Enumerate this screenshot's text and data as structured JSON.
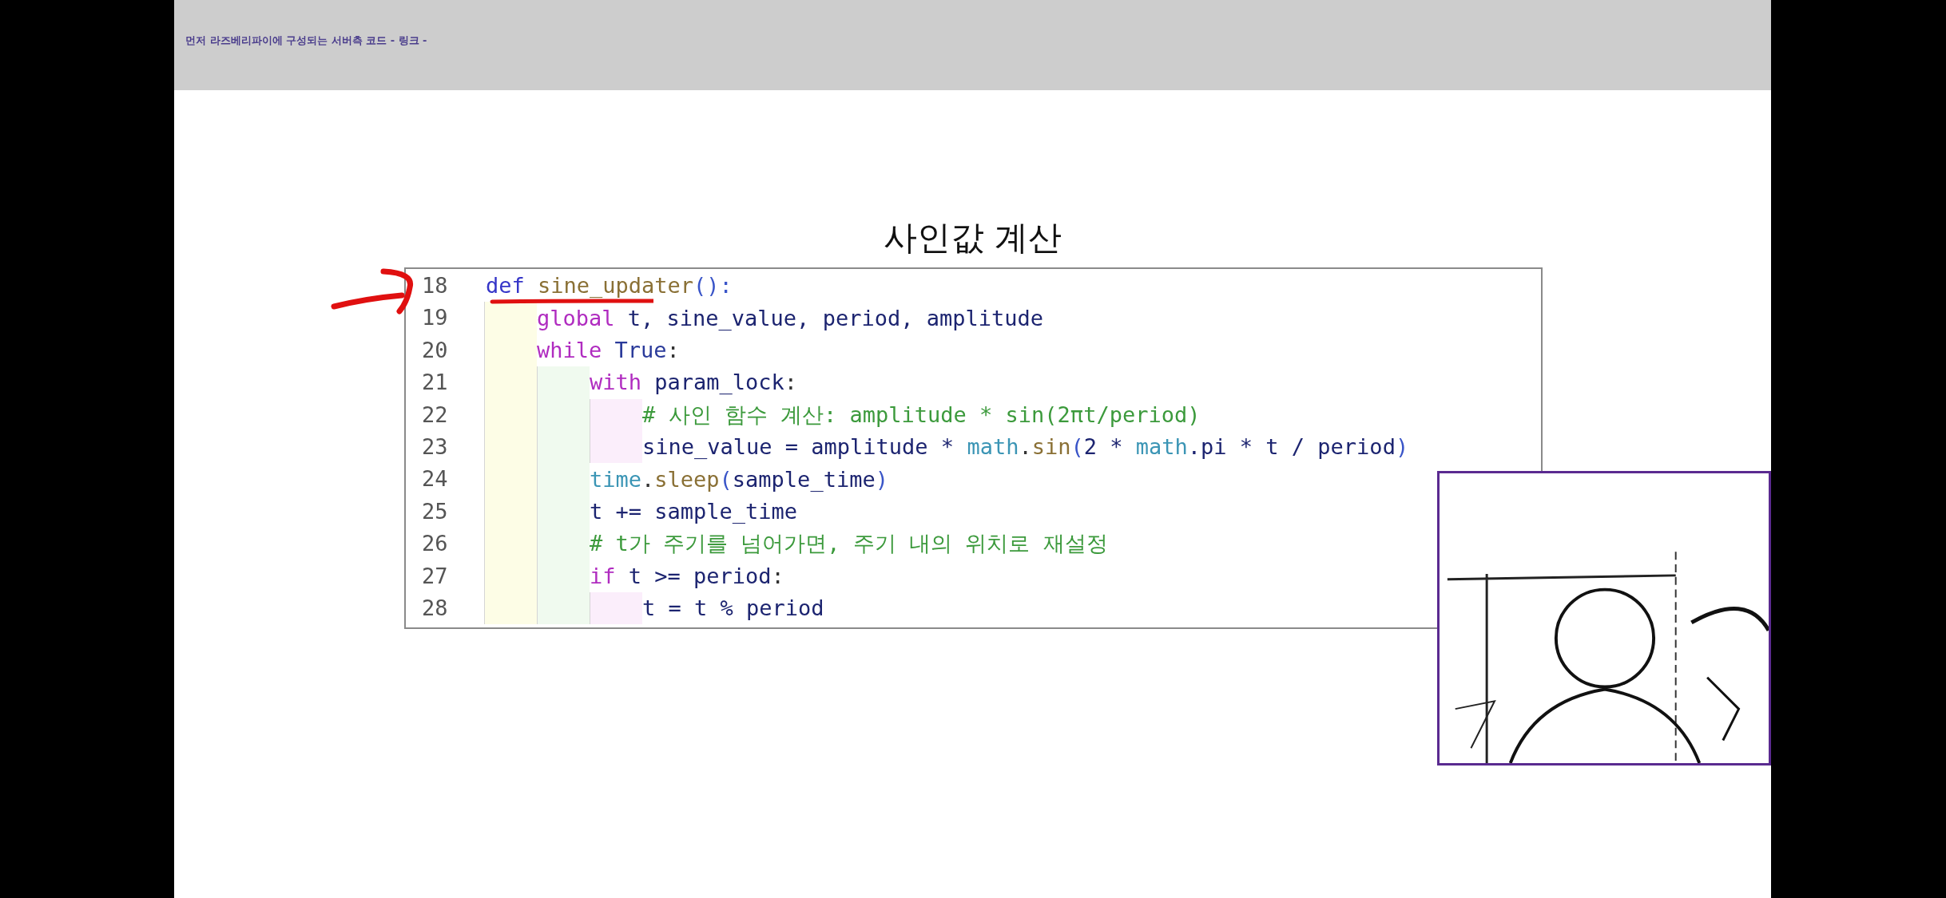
{
  "header": {
    "text": "먼저 라즈베리파이에 구성되는 서버측 코드 - 링크 -"
  },
  "slide": {
    "title": "사인값 계산"
  },
  "code": [
    {
      "number": "18",
      "tokens": [
        {
          "text": "def ",
          "kind": "storage"
        },
        {
          "text": "sine_updater",
          "kind": "function"
        },
        {
          "text": "():",
          "kind": "paren"
        }
      ],
      "children": [
        {
          "number": "19",
          "tokens": [
            {
              "text": "global",
              "kind": "keyword"
            },
            {
              "text": " t, sine_value, period, amplitude",
              "kind": "name"
            }
          ]
        },
        {
          "number": "20",
          "tokens": [
            {
              "text": "while ",
              "kind": "keyword"
            },
            {
              "text": "True",
              "kind": "constant"
            },
            {
              "text": ":",
              "kind": "plain"
            }
          ],
          "children": [
            {
              "number": "21",
              "tokens": [
                {
                  "text": "with",
                  "kind": "keyword"
                },
                {
                  "text": " param_lock",
                  "kind": "name"
                },
                {
                  "text": ":",
                  "kind": "plain"
                }
              ],
              "children": [
                {
                  "number": "22",
                  "tokens": [
                    {
                      "text": "# 사인 함수 계산: amplitude * sin(2πt/period)",
                      "kind": "comment"
                    }
                  ]
                },
                {
                  "number": "23",
                  "tokens": [
                    {
                      "text": "sine_value = amplitude * ",
                      "kind": "name"
                    },
                    {
                      "text": "math",
                      "kind": "module"
                    },
                    {
                      "text": ".",
                      "kind": "plain"
                    },
                    {
                      "text": "sin",
                      "kind": "function"
                    },
                    {
                      "text": "(",
                      "kind": "paren"
                    },
                    {
                      "text": "2 * ",
                      "kind": "name"
                    },
                    {
                      "text": "math",
                      "kind": "module"
                    },
                    {
                      "text": ".pi * t / period",
                      "kind": "name"
                    },
                    {
                      "text": ")",
                      "kind": "paren"
                    }
                  ]
                }
              ]
            },
            {
              "number": "24",
              "tokens": [
                {
                  "text": "time",
                  "kind": "module"
                },
                {
                  "text": ".",
                  "kind": "plain"
                },
                {
                  "text": "sleep",
                  "kind": "function"
                },
                {
                  "text": "(",
                  "kind": "paren"
                },
                {
                  "text": "sample_time",
                  "kind": "name"
                },
                {
                  "text": ")",
                  "kind": "paren"
                }
              ]
            },
            {
              "number": "25",
              "tokens": [
                {
                  "text": "t += sample_time",
                  "kind": "name"
                }
              ]
            },
            {
              "number": "26",
              "tokens": [
                {
                  "text": "# t가 주기를 넘어가면, 주기 내의 위치로 재설정",
                  "kind": "comment"
                }
              ]
            },
            {
              "number": "27",
              "tokens": [
                {
                  "text": "if",
                  "kind": "keyword"
                },
                {
                  "text": " t >= period",
                  "kind": "name"
                },
                {
                  "text": ":",
                  "kind": "plain"
                }
              ],
              "children": [
                {
                  "number": "28",
                  "tokens": [
                    {
                      "text": "t = t % period",
                      "kind": "name"
                    }
                  ]
                }
              ]
            }
          ]
        }
      ]
    }
  ]
}
